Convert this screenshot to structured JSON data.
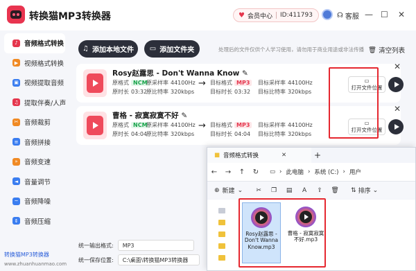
{
  "app": {
    "title": "转换猫MP3转换器",
    "vip_label": "会员中心",
    "user_id": "ID:411793",
    "service_label": "客服",
    "minimize_glyph": "—",
    "maximize_glyph": "☐",
    "close_glyph": "✕"
  },
  "sidebar": {
    "items": [
      {
        "label": "音频格式转换",
        "icon": "music-convert-icon",
        "color": "#e5364d"
      },
      {
        "label": "视频格式转换",
        "icon": "video-convert-icon",
        "color": "#f08a24"
      },
      {
        "label": "视频提取音频",
        "icon": "video-extract-icon",
        "color": "#3a7df0"
      },
      {
        "label": "提取伴奏/人声",
        "icon": "vocal-extract-icon",
        "color": "#e5364d"
      },
      {
        "label": "音频裁剪",
        "icon": "audio-cut-icon",
        "color": "#f08a24"
      },
      {
        "label": "音频拼接",
        "icon": "audio-merge-icon",
        "color": "#3a7df0"
      },
      {
        "label": "音频变速",
        "icon": "audio-speed-icon",
        "color": "#f08a24"
      },
      {
        "label": "音量调节",
        "icon": "volume-icon",
        "color": "#3a7df0"
      },
      {
        "label": "音频降噪",
        "icon": "denoise-icon",
        "color": "#3a7df0"
      },
      {
        "label": "音频压缩",
        "icon": "compress-icon",
        "color": "#3a7df0"
      }
    ],
    "footer_link": "转换猫MP3转换器",
    "footer_url": "www.zhuanhuanmao.com"
  },
  "toolbar": {
    "add_file": "添加本地文件",
    "add_folder": "添加文件夹",
    "notice": "处理后的文件仅供个人学习使用，请勿用于商业用途或非法传播",
    "clear_list": "清空列表"
  },
  "files": [
    {
      "name": "Rosy赵露思 - Don't Wanna Know",
      "src_format_label": "原格式",
      "src_format": "NCM",
      "src_rate_label": "原采样率",
      "src_rate": "44100Hz",
      "src_duration_label": "原时长",
      "src_duration": "03:32",
      "src_bitrate_label": "原比特率",
      "src_bitrate": "320kbps",
      "dst_format_label": "目标格式",
      "dst_format": "MP3",
      "dst_rate_label": "目标采样率",
      "dst_rate": "44100Hz",
      "dst_duration_label": "目标时长",
      "dst_duration": "03:32",
      "dst_bitrate_label": "目标比特率",
      "dst_bitrate": "320kbps",
      "open_folder": "打开文件位置"
    },
    {
      "name": "曹格 - 寂寞寂寞不好",
      "src_format_label": "原格式",
      "src_format": "NCM",
      "src_rate_label": "原采样率",
      "src_rate": "44100Hz",
      "src_duration_label": "原时长",
      "src_duration": "04:04",
      "src_bitrate_label": "原比特率",
      "src_bitrate": "320kbps",
      "dst_format_label": "目标格式",
      "dst_format": "MP3",
      "dst_rate_label": "目标采样率",
      "dst_rate": "44100Hz",
      "dst_duration_label": "目标时长",
      "dst_duration": "04:04",
      "dst_bitrate_label": "目标比特率",
      "dst_bitrate": "320kbps",
      "open_folder": "打开文件位置"
    }
  ],
  "bottom": {
    "output_format_label": "统一输出格式:",
    "output_format": "MP3",
    "save_location_label": "统一保存位置:",
    "save_location": "C:\\桌面\\转换猫MP3转换器"
  },
  "explorer": {
    "tab_title": "音频格式转换",
    "breadcrumb": [
      "此电脑",
      "系统 (C:)",
      "用户"
    ],
    "new_label": "新建",
    "sort_label": "排序",
    "files": [
      {
        "name": "Rosy赵露思 - Don't Wanna Know.mp3"
      },
      {
        "name": "曹格 - 寂寞寂寞不好.mp3"
      }
    ]
  },
  "colors": {
    "accent": "#e5364d",
    "dark_button": "#2c2f3a",
    "highlight_box": "#e5272f"
  }
}
